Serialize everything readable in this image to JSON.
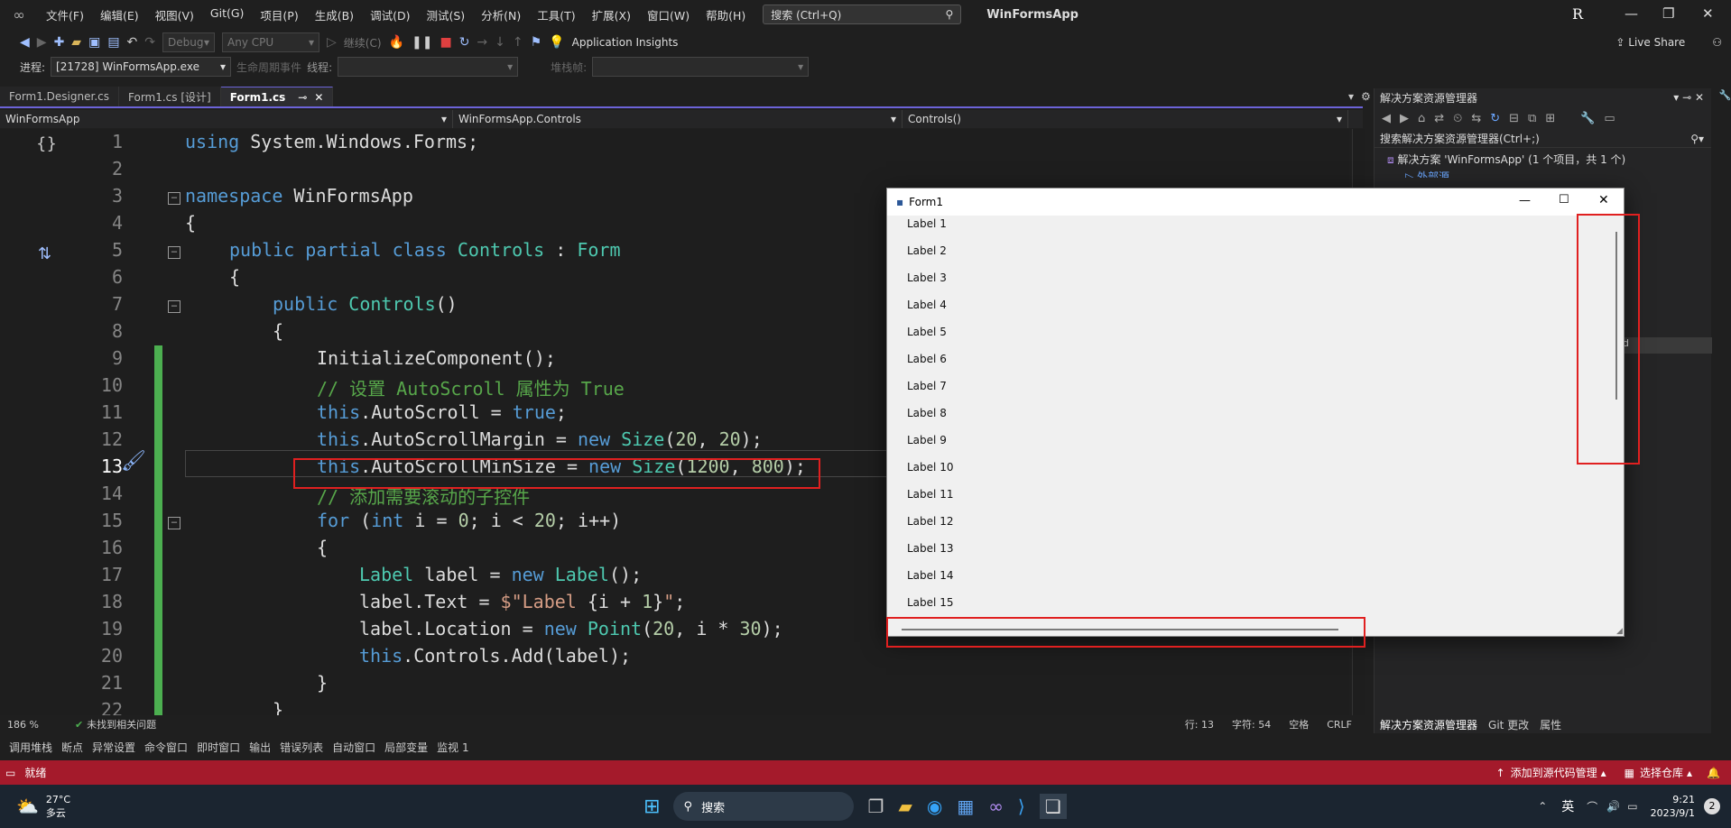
{
  "menu": {
    "items": [
      "文件(F)",
      "编辑(E)",
      "视图(V)",
      "Git(G)",
      "项目(P)",
      "生成(B)",
      "调试(D)",
      "测试(S)",
      "分析(N)",
      "工具(T)",
      "扩展(X)",
      "窗口(W)",
      "帮助(H)"
    ],
    "search_placeholder": "搜索 (Ctrl+Q)",
    "app_title": "WinFormsApp",
    "user_initial": "R"
  },
  "toolbar": {
    "config": "Debug",
    "platform": "Any CPU",
    "continue": "继续(C)",
    "app_insights": "Application Insights",
    "live_share": "Live Share"
  },
  "toolbar2": {
    "process_label": "进程:",
    "process_value": "[21728] WinFormsApp.exe",
    "lifecycle_label": "生命周期事件",
    "thread_label": "线程:",
    "stackframe_label": "堆栈帧:"
  },
  "tabs": [
    "Form1.Designer.cs",
    "Form1.cs [设计]",
    "Form1.cs"
  ],
  "nav": {
    "project": "WinFormsApp",
    "class": "WinFormsApp.Controls",
    "member": "Controls()"
  },
  "code": {
    "lines": [
      {
        "n": "1",
        "t": "using System.Windows.Forms;"
      },
      {
        "n": "2",
        "t": ""
      },
      {
        "n": "3",
        "t": "namespace WinFormsApp"
      },
      {
        "n": "4",
        "t": "{"
      },
      {
        "n": "5",
        "t": "public partial class Controls : Form"
      },
      {
        "n": "6",
        "t": "{"
      },
      {
        "n": "7",
        "t": "public Controls()"
      },
      {
        "n": "8",
        "t": "{"
      },
      {
        "n": "9",
        "t": "InitializeComponent();"
      },
      {
        "n": "10",
        "t": "// 设置 AutoScroll 属性为 True"
      },
      {
        "n": "11",
        "t": "this.AutoScroll = true;"
      },
      {
        "n": "12",
        "t": "this.AutoScrollMargin = new Size(20, 20);"
      },
      {
        "n": "13",
        "t": "this.AutoScrollMinSize = new Size(1200, 800);"
      },
      {
        "n": "14",
        "t": "// 添加需要滚动的子控件"
      },
      {
        "n": "15",
        "t": "for (int i = 0; i < 20; i++)"
      },
      {
        "n": "16",
        "t": "{"
      },
      {
        "n": "17",
        "t": "Label label = new Label();"
      },
      {
        "n": "18",
        "t": "label.Text = $\"Label {i + 1}\";"
      },
      {
        "n": "19",
        "t": "label.Location = new Point(20, i * 30);"
      },
      {
        "n": "20",
        "t": "this.Controls.Add(label);"
      },
      {
        "n": "21",
        "t": "}"
      },
      {
        "n": "22",
        "t": "}"
      }
    ]
  },
  "editor_status": {
    "zoom": "186 %",
    "issues": "未找到相关问题",
    "line": "行: 13",
    "col": "字符: 54",
    "ws": "空格",
    "eol": "CRLF"
  },
  "panel_tabs": [
    "调用堆栈",
    "断点",
    "异常设置",
    "命令窗口",
    "即时窗口",
    "输出",
    "错误列表",
    "自动窗口",
    "局部变量",
    "监视 1"
  ],
  "statusbar": {
    "ready": "就绪",
    "add_source": "添加到源代码管理",
    "select_repo": "选择仓库"
  },
  "solution": {
    "title": "解决方案资源管理器",
    "search": "搜索解决方案资源管理器(Ctrl+;)",
    "root": "解决方案 'WinFormsApp' (1 个项目，共 1 个)",
    "child": "外部源",
    "side_text": "id",
    "bottom_tabs": [
      "解决方案资源管理器",
      "Git 更改",
      "属性"
    ]
  },
  "form1": {
    "title": "Form1",
    "labels": [
      "Label 1",
      "Label 2",
      "Label 3",
      "Label 4",
      "Label 5",
      "Label 6",
      "Label 7",
      "Label 8",
      "Label 9",
      "Label 10",
      "Label 11",
      "Label 12",
      "Label 13",
      "Label 14",
      "Label 15"
    ]
  },
  "taskbar": {
    "weather_temp": "27°C",
    "weather_desc": "多云",
    "search": "搜索",
    "ime": "英",
    "time": "9:21",
    "date": "2023/9/1",
    "notif": "2"
  },
  "colors": {
    "accent": "#6c63d8",
    "status": "#a41a2b",
    "highlight": "#e02020"
  }
}
